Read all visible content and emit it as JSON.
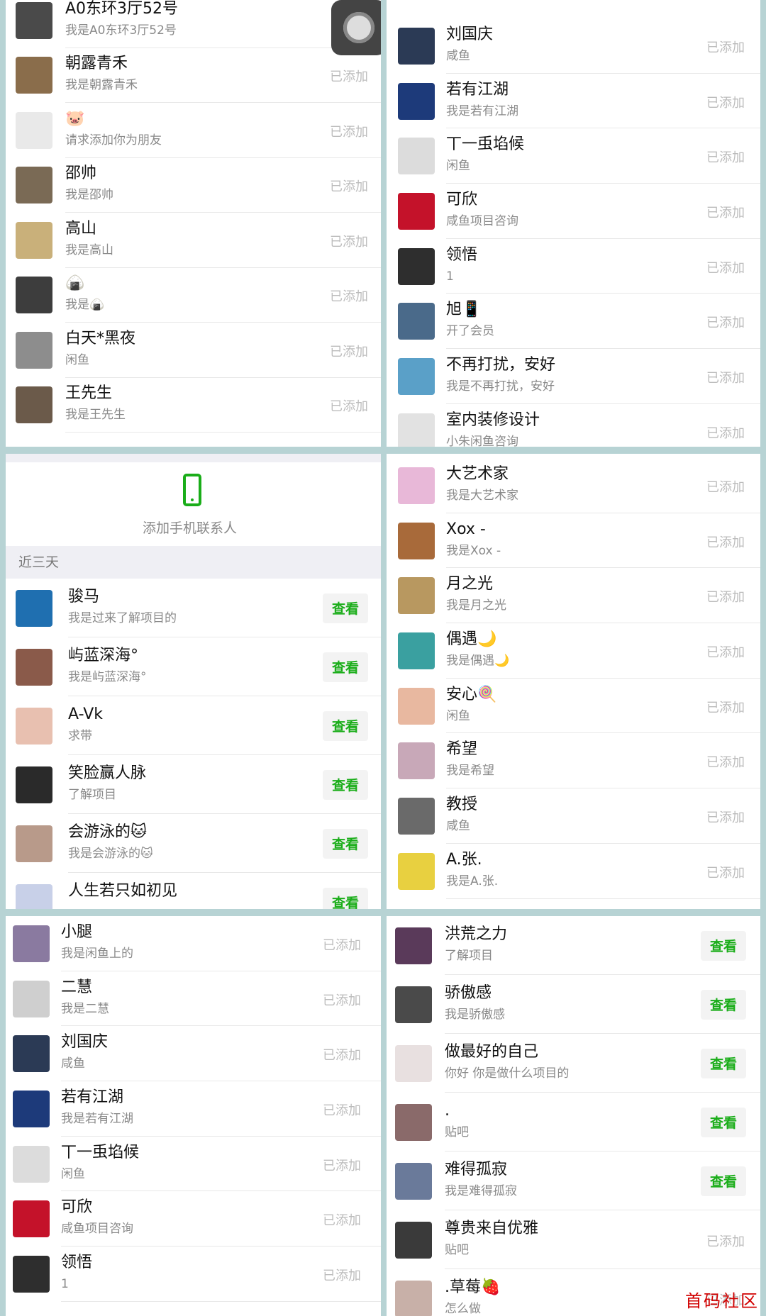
{
  "panels": {
    "top_left": {
      "rows": [
        {
          "name": "A0东环3厅52号",
          "sub": "我是A0东环3厅52号",
          "status": "",
          "color": "#4a4a4a"
        },
        {
          "name": "朝露青禾",
          "sub": "我是朝露青禾",
          "status": "已添加",
          "color": "#8a6d4b"
        },
        {
          "name": "🐷",
          "sub": "请求添加你为朋友",
          "status": "已添加",
          "color": "#e9e9e9"
        },
        {
          "name": "邵帅",
          "sub": "我是邵帅",
          "status": "已添加",
          "color": "#7a6a55"
        },
        {
          "name": "高山",
          "sub": "我是高山",
          "status": "已添加",
          "color": "#c9b07a"
        },
        {
          "name": "🍙",
          "sub": "我是🍙",
          "status": "已添加",
          "color": "#3d3d3d"
        },
        {
          "name": "白天*黑夜",
          "sub": "闲鱼",
          "status": "已添加",
          "color": "#8d8d8d"
        },
        {
          "name": "王先生",
          "sub": "我是王先生",
          "status": "已添加",
          "color": "#6b5a4a"
        }
      ]
    },
    "top_right": {
      "rows": [
        {
          "name": "刘国庆",
          "sub": "咸鱼",
          "status": "已添加",
          "color": "#2b3a55"
        },
        {
          "name": "若有江湖",
          "sub": "我是若有江湖",
          "status": "已添加",
          "color": "#1d3a7a"
        },
        {
          "name": "丅一䖝埳候",
          "sub": "闲鱼",
          "status": "已添加",
          "color": "#dcdcdc"
        },
        {
          "name": "可欣",
          "sub": "咸鱼项目咨询",
          "status": "已添加",
          "color": "#c4122a"
        },
        {
          "name": "领悟",
          "sub": "1",
          "status": "已添加",
          "color": "#2e2e2e"
        },
        {
          "name": "旭📱",
          "sub": "开了会员",
          "status": "已添加",
          "color": "#4a6a8a"
        },
        {
          "name": "不再打扰，安好",
          "sub": "我是不再打扰，安好",
          "status": "已添加",
          "color": "#5aa0c8"
        },
        {
          "name": "室内装修设计",
          "sub": "小朱闲鱼咨询",
          "status": "已添加",
          "color": "#e2e2e2"
        }
      ]
    },
    "mid_left": {
      "phone_label": "添加手机联系人",
      "section_title": "近三天",
      "rows": [
        {
          "name": "骏马",
          "sub": "我是过来了解项目的",
          "button": "查看",
          "color": "#1f6fb0"
        },
        {
          "name": "屿蓝深海°",
          "sub": "我是屿蓝深海°",
          "button": "查看",
          "color": "#8a5a4a"
        },
        {
          "name": "A-Vk",
          "sub": "求带",
          "button": "查看",
          "color": "#e8c0b0"
        },
        {
          "name": "笑脸赢人脉",
          "sub": "了解项目",
          "button": "查看",
          "color": "#2a2a2a"
        },
        {
          "name": "会游泳的🐱",
          "sub": "我是会游泳的🐱",
          "button": "查看",
          "color": "#b89a8a"
        },
        {
          "name": "人生若只如初见",
          "sub": "",
          "button": "查看",
          "color": "#c8d0e8"
        }
      ]
    },
    "mid_right": {
      "rows": [
        {
          "name": "大艺术家",
          "sub": "我是大艺术家",
          "status": "已添加",
          "color": "#e8b8d8"
        },
        {
          "name": "Xox -",
          "sub": "我是Xox -",
          "status": "已添加",
          "color": "#a86a3a"
        },
        {
          "name": "月之光",
          "sub": "我是月之光",
          "status": "已添加",
          "color": "#b89860"
        },
        {
          "name": "偶遇🌙",
          "sub": "我是偶遇🌙",
          "status": "已添加",
          "color": "#3aa0a0"
        },
        {
          "name": "安心🍭",
          "sub": "闲鱼",
          "status": "已添加",
          "color": "#e8b8a0"
        },
        {
          "name": "希望",
          "sub": "我是希望",
          "status": "已添加",
          "color": "#c8a8b8"
        },
        {
          "name": "教授",
          "sub": "咸鱼",
          "status": "已添加",
          "color": "#6a6a6a"
        },
        {
          "name": "A.张.",
          "sub": "我是A.张.",
          "status": "已添加",
          "color": "#e8d040"
        }
      ]
    },
    "bottom_left": {
      "rows": [
        {
          "name": "小腿",
          "sub": "我是闲鱼上的",
          "status": "已添加",
          "color": "#8a7aa0"
        },
        {
          "name": "二慧",
          "sub": "我是二慧",
          "status": "已添加",
          "color": "#cfcfcf"
        },
        {
          "name": "刘国庆",
          "sub": "咸鱼",
          "status": "已添加",
          "color": "#2b3a55"
        },
        {
          "name": "若有江湖",
          "sub": "我是若有江湖",
          "status": "已添加",
          "color": "#1d3a7a"
        },
        {
          "name": "丅一䖝埳候",
          "sub": "闲鱼",
          "status": "已添加",
          "color": "#dcdcdc"
        },
        {
          "name": "可欣",
          "sub": "咸鱼项目咨询",
          "status": "已添加",
          "color": "#c4122a"
        },
        {
          "name": "领悟",
          "sub": "1",
          "status": "已添加",
          "color": "#2e2e2e"
        }
      ]
    },
    "bottom_right": {
      "rows": [
        {
          "name": "洪荒之力",
          "sub": "了解项目",
          "button": "查看",
          "status": "",
          "color": "#5a3a5a"
        },
        {
          "name": "骄傲感",
          "sub": "我是骄傲感",
          "button": "查看",
          "status": "",
          "color": "#4a4a4a"
        },
        {
          "name": "做最好的自己",
          "sub": "你好 你是做什么项目的",
          "button": "查看",
          "status": "",
          "color": "#e8e0e0"
        },
        {
          "name": ".",
          "sub": "贴吧",
          "button": "查看",
          "status": "",
          "color": "#8a6a6a"
        },
        {
          "name": "难得孤寂",
          "sub": "我是难得孤寂",
          "button": "查看",
          "status": "",
          "color": "#6a7a9a"
        },
        {
          "name": "尊贵来自优雅",
          "sub": "贴吧",
          "button": "",
          "status": "已添加",
          "color": "#3a3a3a"
        },
        {
          "name": ".草莓🍓",
          "sub": "怎么做",
          "button": "",
          "status": "已添加",
          "color": "#c8b0a8"
        }
      ]
    }
  },
  "watermark": "首码社区"
}
